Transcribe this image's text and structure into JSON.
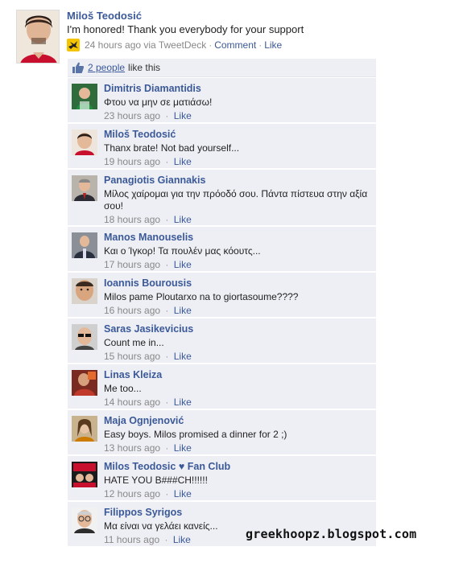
{
  "post": {
    "author": "Miloš Teodosić",
    "text": "I'm honored! Thank you everybody for your support",
    "time": "24 hours ago via TweetDeck",
    "comment_label": "Comment",
    "like_label": "Like",
    "via_icon": "tweetdeck-icon"
  },
  "likes": {
    "people": "2 people",
    "suffix": "like this",
    "icon": "thumbs-up-icon"
  },
  "comments": [
    {
      "name": "Dimitris Diamantidis",
      "text": "Φτου να μην σε ματιάσω!",
      "time": "23 hours ago",
      "like": "Like",
      "avatar": "green"
    },
    {
      "name": "Miloš Teodosić",
      "text": "Thanx brate! Not bad yourself...",
      "time": "19 hours ago",
      "like": "Like",
      "avatar": "milos"
    },
    {
      "name": "Panagiotis Giannakis",
      "text": "Μίλος χαίρομαι για την πρόοδό σου. Πάντα πίστευα στην αξία σου!",
      "time": "18 hours ago",
      "like": "Like",
      "avatar": "suit"
    },
    {
      "name": "Manos Manouselis",
      "text": "Και ο Ίγκορ! Τα πουλέν μας κόουτς...",
      "time": "17 hours ago",
      "like": "Like",
      "avatar": "suit2"
    },
    {
      "name": "Ioannis Bourousis",
      "text": "Milos pame Ploutarxo na to giortasoume????",
      "time": "16 hours ago",
      "like": "Like",
      "avatar": "face"
    },
    {
      "name": "Saras Jasikevicius",
      "text": "Count me in...",
      "time": "15 hours ago",
      "like": "Like",
      "avatar": "sunglasses"
    },
    {
      "name": "Linas Kleiza",
      "text": "Me too...",
      "time": "14 hours ago",
      "like": "Like",
      "avatar": "red"
    },
    {
      "name": "Maja Ognjenović",
      "text": "Easy boys. Milos promised a dinner for 2 ;)",
      "time": "13 hours ago",
      "like": "Like",
      "avatar": "maja"
    },
    {
      "name": "Milos Teodosic ♥ Fan Club",
      "text": "HATE YOU B###CH!!!!!!",
      "time": "12 hours ago",
      "like": "Like",
      "avatar": "fans"
    },
    {
      "name": "Filippos Syrigos",
      "text": "Μα είναι να γελάει κανείς...",
      "time": "11 hours ago",
      "like": "Like",
      "avatar": "glasses"
    }
  ],
  "watermark": "greekhoopz.blogspot.com"
}
